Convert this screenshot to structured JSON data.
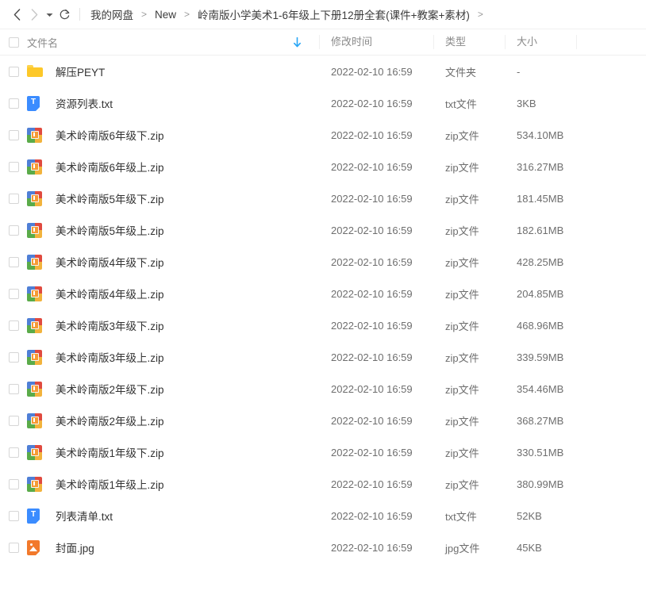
{
  "toolbar": {
    "back_icon": "chevron-left-icon",
    "forward_icon": "chevron-right-icon",
    "history_caret_icon": "caret-down-icon",
    "refresh_icon": "refresh-icon",
    "breadcrumb": {
      "items": [
        "我的网盘",
        "New",
        "岭南版小学美术1-6年级上下册12册全套(课件+教案+素材)"
      ],
      "separator": ">",
      "trailing_separator": ">"
    }
  },
  "columns": {
    "name": "文件名",
    "modified": "修改时间",
    "type": "类型",
    "size": "大小",
    "sort_icon": "sort-descending-arrow-icon",
    "sort_color": "#29a6f5",
    "select_all_checkbox": "select-all-checkbox"
  },
  "files": [
    {
      "icon": "folder-icon",
      "name": "解压PEYT",
      "modified": "2022-02-10 16:59",
      "type": "文件夹",
      "size": "-"
    },
    {
      "icon": "txt-file-icon",
      "name": "资源列表.txt",
      "modified": "2022-02-10 16:59",
      "type": "txt文件",
      "size": "3KB"
    },
    {
      "icon": "zip-file-icon",
      "name": "美术岭南版6年级下.zip",
      "modified": "2022-02-10 16:59",
      "type": "zip文件",
      "size": "534.10MB"
    },
    {
      "icon": "zip-file-icon",
      "name": "美术岭南版6年级上.zip",
      "modified": "2022-02-10 16:59",
      "type": "zip文件",
      "size": "316.27MB"
    },
    {
      "icon": "zip-file-icon",
      "name": "美术岭南版5年级下.zip",
      "modified": "2022-02-10 16:59",
      "type": "zip文件",
      "size": "181.45MB"
    },
    {
      "icon": "zip-file-icon",
      "name": "美术岭南版5年级上.zip",
      "modified": "2022-02-10 16:59",
      "type": "zip文件",
      "size": "182.61MB"
    },
    {
      "icon": "zip-file-icon",
      "name": "美术岭南版4年级下.zip",
      "modified": "2022-02-10 16:59",
      "type": "zip文件",
      "size": "428.25MB"
    },
    {
      "icon": "zip-file-icon",
      "name": "美术岭南版4年级上.zip",
      "modified": "2022-02-10 16:59",
      "type": "zip文件",
      "size": "204.85MB"
    },
    {
      "icon": "zip-file-icon",
      "name": "美术岭南版3年级下.zip",
      "modified": "2022-02-10 16:59",
      "type": "zip文件",
      "size": "468.96MB"
    },
    {
      "icon": "zip-file-icon",
      "name": "美术岭南版3年级上.zip",
      "modified": "2022-02-10 16:59",
      "type": "zip文件",
      "size": "339.59MB"
    },
    {
      "icon": "zip-file-icon",
      "name": "美术岭南版2年级下.zip",
      "modified": "2022-02-10 16:59",
      "type": "zip文件",
      "size": "354.46MB"
    },
    {
      "icon": "zip-file-icon",
      "name": "美术岭南版2年级上.zip",
      "modified": "2022-02-10 16:59",
      "type": "zip文件",
      "size": "368.27MB"
    },
    {
      "icon": "zip-file-icon",
      "name": "美术岭南版1年级下.zip",
      "modified": "2022-02-10 16:59",
      "type": "zip文件",
      "size": "330.51MB"
    },
    {
      "icon": "zip-file-icon",
      "name": "美术岭南版1年级上.zip",
      "modified": "2022-02-10 16:59",
      "type": "zip文件",
      "size": "380.99MB"
    },
    {
      "icon": "txt-file-icon",
      "name": "列表清单.txt",
      "modified": "2022-02-10 16:59",
      "type": "txt文件",
      "size": "52KB"
    },
    {
      "icon": "jpg-file-icon",
      "name": "封面.jpg",
      "modified": "2022-02-10 16:59",
      "type": "jpg文件",
      "size": "45KB"
    }
  ]
}
